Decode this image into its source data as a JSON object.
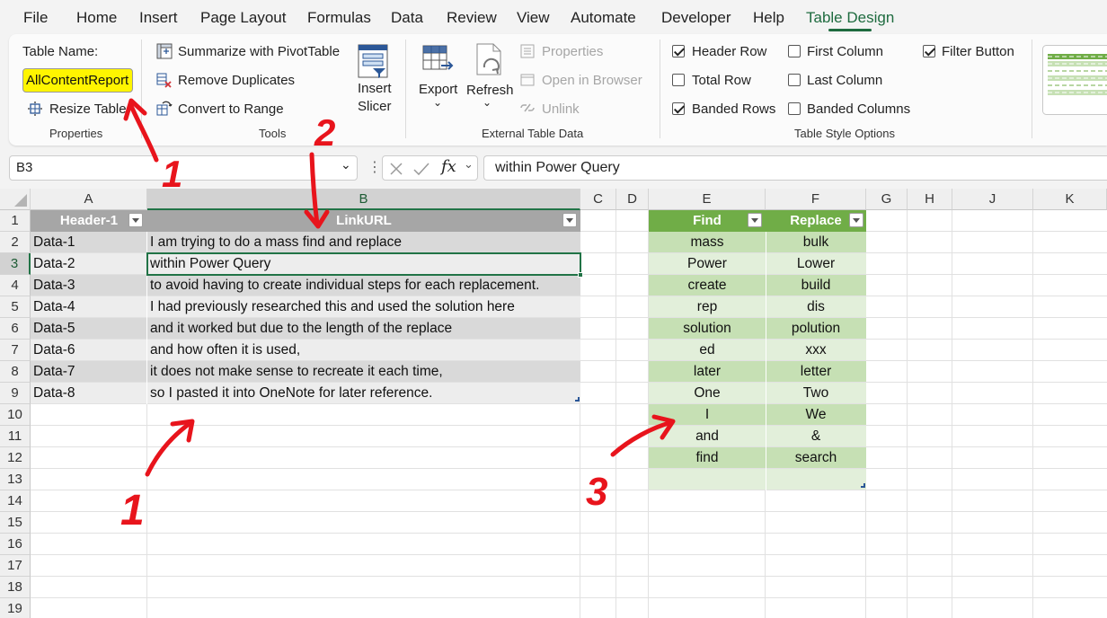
{
  "menu": {
    "tabs": [
      "File",
      "Home",
      "Insert",
      "Page Layout",
      "Formulas",
      "Data",
      "Review",
      "View",
      "Automate",
      "Developer",
      "Help",
      "Table Design"
    ],
    "active": "Table Design"
  },
  "ribbon": {
    "properties": {
      "table_name_label": "Table Name:",
      "table_name_value": "AllContentReport",
      "resize_label": "Resize Table",
      "group_label": "Properties"
    },
    "tools": {
      "summarize_label": "Summarize with PivotTable",
      "remove_duplicates_label": "Remove Duplicates",
      "convert_label": "Convert to Range",
      "insert_slicer_line1": "Insert",
      "insert_slicer_line2": "Slicer",
      "group_label": "Tools"
    },
    "external": {
      "export_label": "Export",
      "refresh_label": "Refresh",
      "properties_label": "Properties",
      "open_browser_label": "Open in Browser",
      "unlink_label": "Unlink",
      "group_label": "External Table Data"
    },
    "style_options": {
      "header_row": {
        "label": "Header Row",
        "checked": true
      },
      "total_row": {
        "label": "Total Row",
        "checked": false
      },
      "banded_rows": {
        "label": "Banded Rows",
        "checked": true
      },
      "first_column": {
        "label": "First Column",
        "checked": false
      },
      "last_column": {
        "label": "Last Column",
        "checked": false
      },
      "banded_columns": {
        "label": "Banded Columns",
        "checked": false
      },
      "filter_button": {
        "label": "Filter Button",
        "checked": true
      },
      "group_label": "Table Style Options"
    }
  },
  "formula_bar": {
    "cell_ref": "B3",
    "fx_symbol": "fx",
    "value": "within Power Query"
  },
  "sheet": {
    "columns": [
      "A",
      "B",
      "C",
      "D",
      "E",
      "F",
      "G",
      "H",
      "J",
      "K"
    ],
    "rows": [
      "1",
      "2",
      "3",
      "4",
      "5",
      "6",
      "7",
      "8",
      "9",
      "10",
      "11",
      "12",
      "13",
      "14",
      "15",
      "16",
      "17",
      "18",
      "19"
    ],
    "table1": {
      "headers": [
        "Header-1",
        "LinkURL"
      ],
      "rows": [
        [
          "Data-1",
          "I am trying to do a mass find and replace"
        ],
        [
          "Data-2",
          "within Power Query"
        ],
        [
          "Data-3",
          "to avoid having to create individual steps for each replacement."
        ],
        [
          "Data-4",
          "I had previously researched this and used the solution here"
        ],
        [
          "Data-5",
          "and it worked but due to the length of the replace"
        ],
        [
          "Data-6",
          "and how often it is used,"
        ],
        [
          "Data-7",
          "it does not make sense to recreate it each time,"
        ],
        [
          "Data-8",
          "so I pasted it into OneNote for later reference."
        ]
      ]
    },
    "table2": {
      "headers": [
        "Find",
        "Replace"
      ],
      "rows": [
        [
          "mass",
          "bulk"
        ],
        [
          "Power",
          "Lower"
        ],
        [
          "create",
          "build"
        ],
        [
          "rep",
          "dis"
        ],
        [
          "solution",
          "polution"
        ],
        [
          "ed",
          "xxx"
        ],
        [
          "later",
          "letter"
        ],
        [
          "One",
          "Two"
        ],
        [
          "I",
          "We"
        ],
        [
          "and",
          "&"
        ],
        [
          "find",
          "search"
        ],
        [
          "",
          ""
        ]
      ]
    }
  },
  "annotations": [
    "1",
    "2",
    "1",
    "3"
  ],
  "colors": {
    "accent": "#1e6b3f",
    "highlight": "#fff500",
    "annotation_red": "#e8141c",
    "table1_header": "#a6a6a6",
    "table2_header": "#70ad47"
  }
}
